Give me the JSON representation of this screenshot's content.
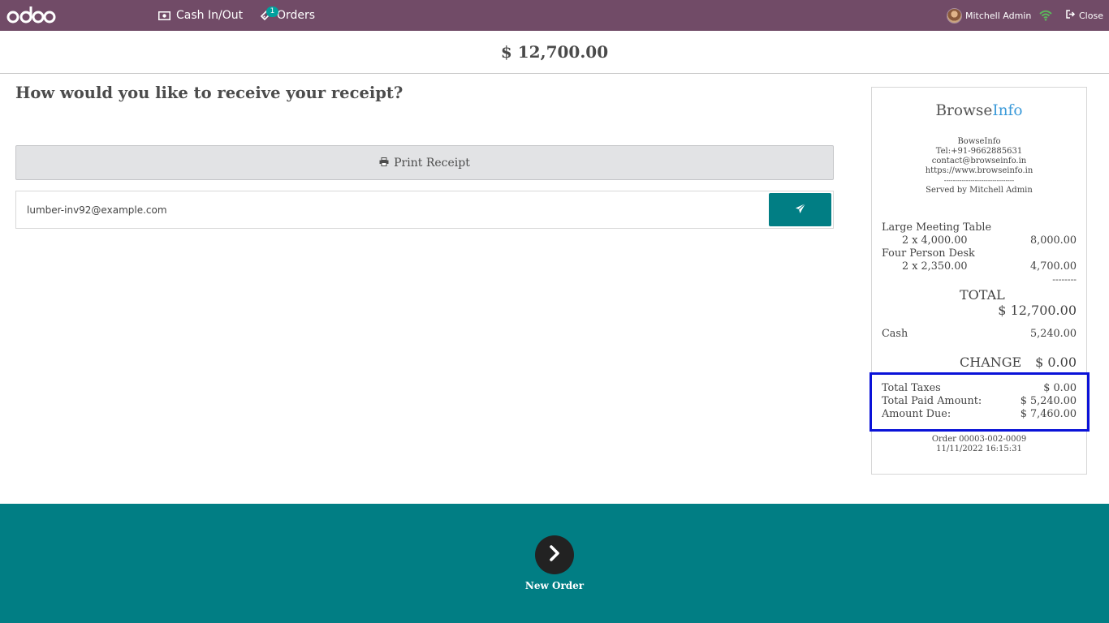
{
  "navbar": {
    "logo": "odoo",
    "cash_in_out_label": "Cash In/Out",
    "orders_label": "Orders",
    "orders_badge": "1",
    "user_name": "Mitchell Admin",
    "close_label": "Close",
    "icons": [
      "cash-register-icon",
      "ticket-icon",
      "wifi-icon",
      "sign-out-icon"
    ]
  },
  "header": {
    "total_amount": "$ 12,700.00"
  },
  "receipt_options": {
    "question": "How would you like to receive your receipt?",
    "print_label": "Print Receipt",
    "email_value": "lumber-inv92@example.com"
  },
  "receipt": {
    "logo_part1": "Browse",
    "logo_part2": "Info",
    "company": "BowseInfo",
    "phone": "Tel:+91-9662885631",
    "email": "contact@browseinfo.in",
    "website": "https://www.browseinfo.in",
    "separator": "--------------------------------",
    "served_by": "Served by Mitchell Admin",
    "lines": [
      {
        "product": "Large Meeting Table",
        "qty_price": "2 x 4,000.00",
        "amount": "8,000.00"
      },
      {
        "product": "Four Person Desk",
        "qty_price": "2 x 2,350.00",
        "amount": "4,700.00"
      }
    ],
    "total_separator": "--------",
    "total_label": "TOTAL",
    "total_value": "$ 12,700.00",
    "payment_method": "Cash",
    "payment_amount": "5,240.00",
    "change_label": "CHANGE",
    "change_value": "$ 0.00",
    "total_taxes_label": "Total Taxes",
    "total_taxes_value": "$ 0.00",
    "total_paid_label": "Total Paid Amount:",
    "total_paid_value": "$ 5,240.00",
    "amount_due_label": "Amount Due:",
    "amount_due_value": "$ 7,460.00",
    "order_ref": "Order 00003-002-0009",
    "order_date": "11/11/2022 16:15:31"
  },
  "colors": {
    "navbar": "#714b67",
    "accent": "#017e84",
    "highlight_border": "#0a12d8",
    "logo_info": "#3b9ad9",
    "wifi": "#28a745"
  },
  "footer": {
    "new_order_label": "New Order"
  }
}
